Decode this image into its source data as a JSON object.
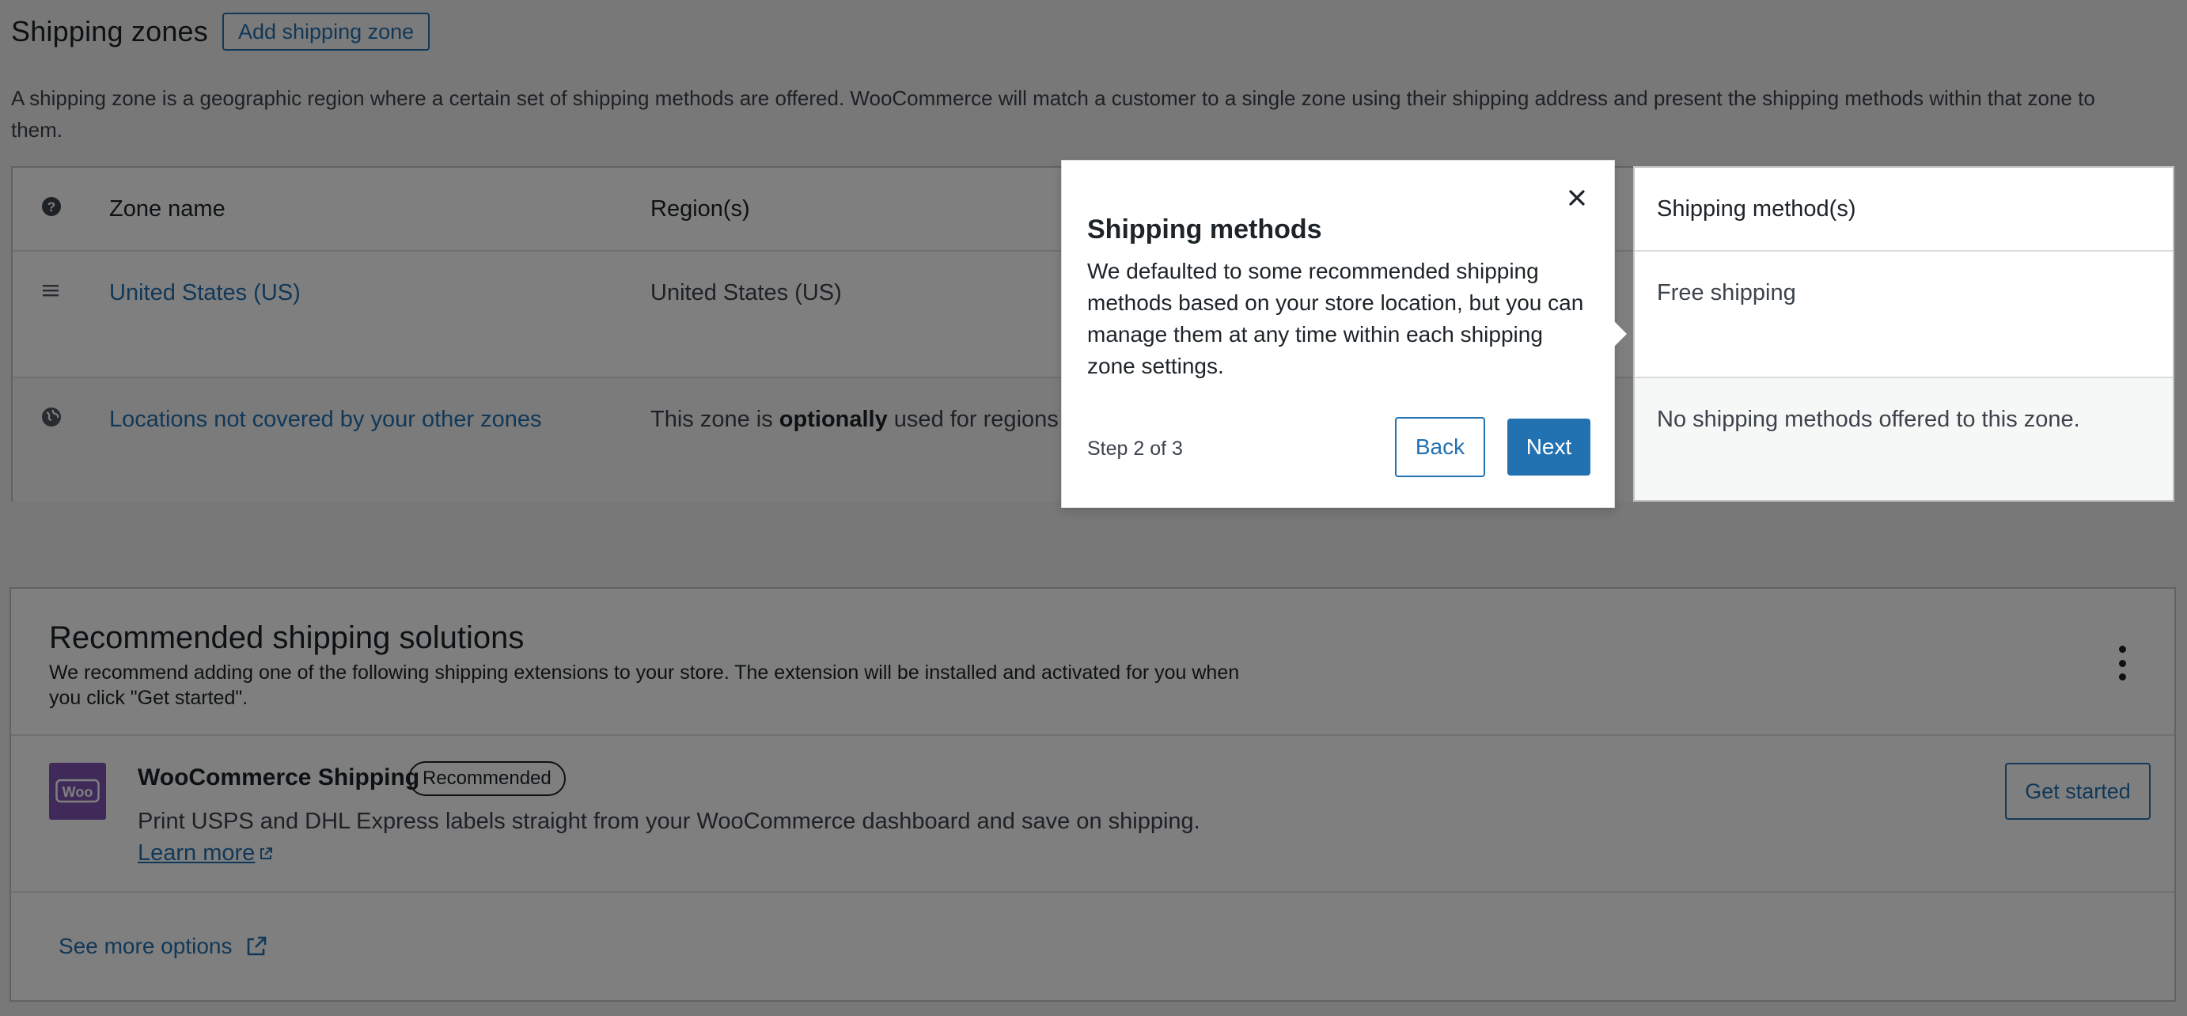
{
  "header": {
    "title": "Shipping zones",
    "add_button": "Add shipping zone",
    "intro": "A shipping zone is a geographic region where a certain set of shipping methods are offered. WooCommerce will match a customer to a single zone using their shipping address and present the shipping methods within that zone to them."
  },
  "table": {
    "columns": {
      "zone_name": "Zone name",
      "regions": "Region(s)",
      "methods": "Shipping method(s)"
    },
    "rows": [
      {
        "icon": "drag-handle-icon",
        "name": "United States (US)",
        "region": "United States (US)",
        "methods": "Free shipping"
      },
      {
        "icon": "globe-icon",
        "name": "Locations not covered by your other zones",
        "region_prefix": "This zone is ",
        "region_bold": "optionally",
        "region_suffix": " used for regions t",
        "methods": "No shipping methods offered to this zone."
      }
    ]
  },
  "tour": {
    "title": "Shipping methods",
    "body": "We defaulted to some recommended shipping methods based on your store location, but you can manage them at any time within each shipping zone settings.",
    "step": "Step 2 of 3",
    "back": "Back",
    "next": "Next"
  },
  "recommended": {
    "title": "Recommended shipping solutions",
    "description": "We recommend adding one of the following shipping extensions to your store. The extension will be installed and activated for you when you click \"Get started\".",
    "item": {
      "logo_text": "Woo",
      "name": "WooCommerce Shipping",
      "badge": "Recommended",
      "description": "Print USPS and DHL Express labels straight from your WooCommerce dashboard and save on shipping.",
      "learn_more": "Learn more",
      "cta": "Get started"
    },
    "see_more": "See more options"
  },
  "colors": {
    "accent": "#2271b1",
    "woo_purple": "#7f54b3",
    "text": "#1d2327",
    "border": "#c3c4c7"
  }
}
